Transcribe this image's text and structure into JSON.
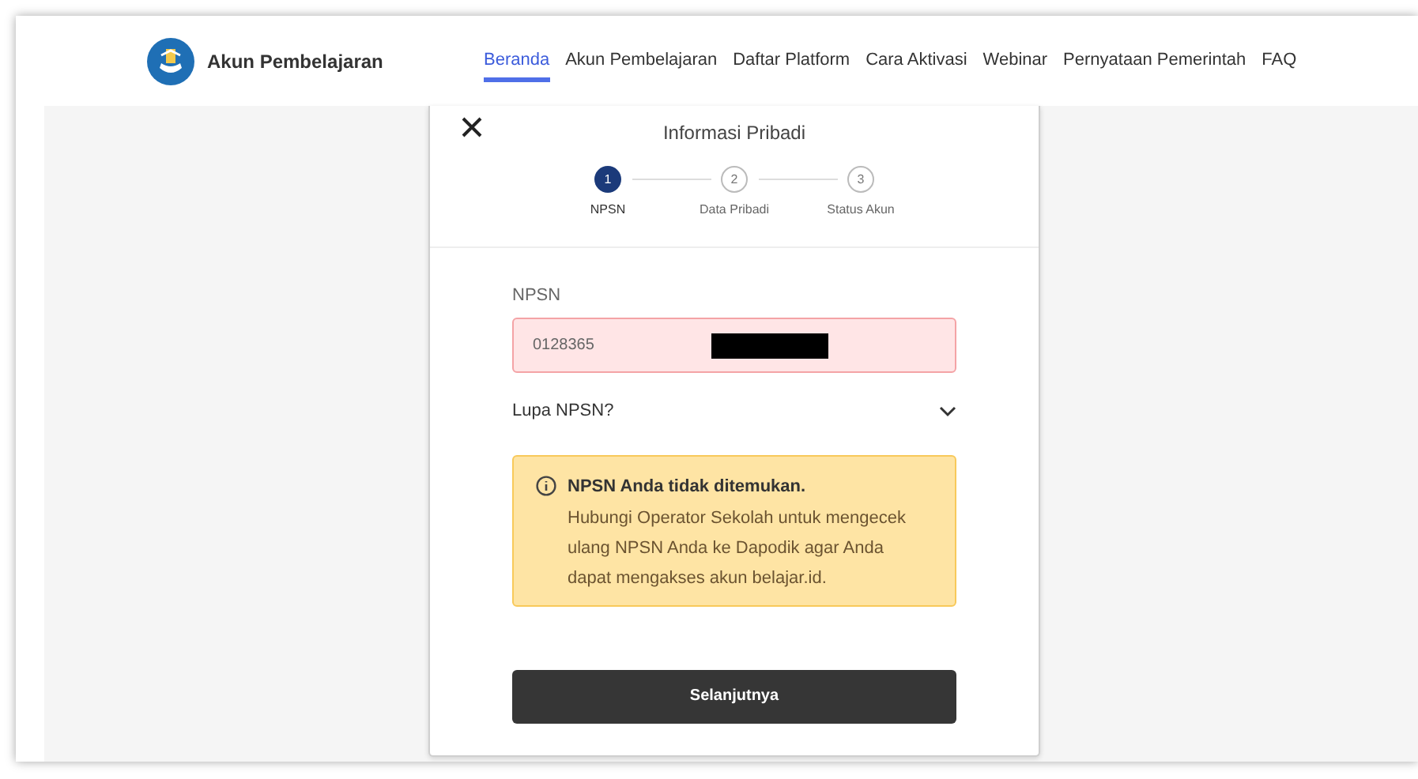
{
  "brand": {
    "name": "Akun Pembelajaran"
  },
  "nav": [
    {
      "label": "Beranda",
      "selected": true
    },
    {
      "label": "Akun Pembelajaran",
      "selected": false
    },
    {
      "label": "Daftar Platform",
      "selected": false
    },
    {
      "label": "Cara Aktivasi",
      "selected": false
    },
    {
      "label": "Webinar",
      "selected": false
    },
    {
      "label": "Pernyataan Pemerintah",
      "selected": false
    },
    {
      "label": "FAQ",
      "selected": false
    }
  ],
  "modal": {
    "title": "Informasi Pribadi",
    "steps": [
      {
        "number": "1",
        "label": "NPSN",
        "selected": true
      },
      {
        "number": "2",
        "label": "Data Pribadi",
        "selected": false
      },
      {
        "number": "3",
        "label": "Status Akun",
        "selected": false
      }
    ],
    "field": {
      "label": "NPSN",
      "value": "0128365",
      "error": true
    },
    "expander": {
      "label": "Lupa NPSN?",
      "expanded": false
    },
    "alert": {
      "title": "NPSN Anda tidak ditemukan.",
      "message": "Hubungi Operator Sekolah untuk mengecek ulang NPSN Anda ke Dapodik agar Anda dapat mengakses akun belajar.id."
    },
    "button": "Selanjutnya"
  }
}
